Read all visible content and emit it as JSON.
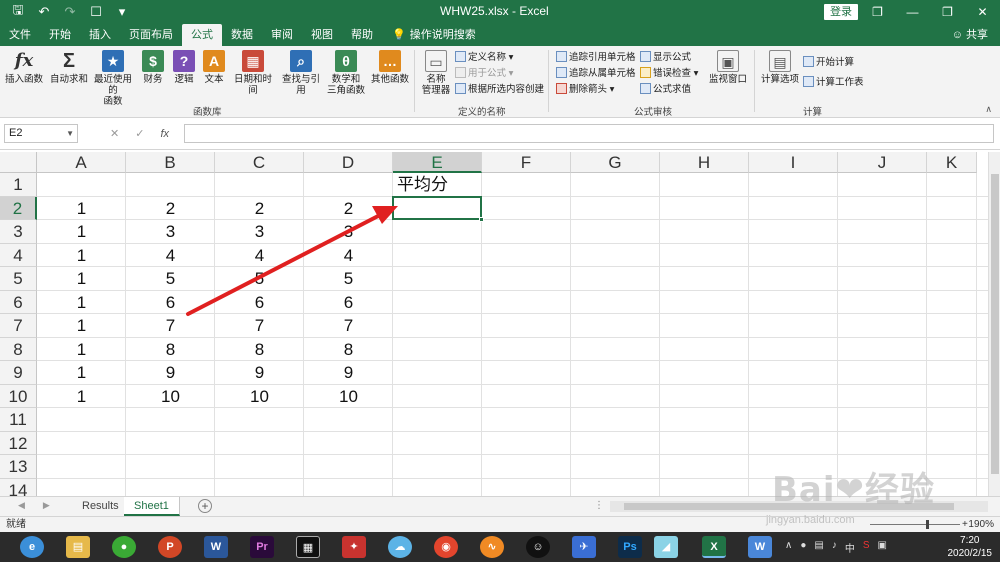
{
  "titlebar": {
    "title": "WHW25.xlsx  -  Excel",
    "login": "登录",
    "qat": [
      "🖫",
      "↶",
      "↷",
      "☐",
      "▾"
    ],
    "controls": [
      "❐",
      "—",
      "❐",
      "✕"
    ]
  },
  "tabs": [
    "文件",
    "开始",
    "插入",
    "页面布局",
    "公式",
    "数据",
    "审阅",
    "视图",
    "帮助"
  ],
  "active_tab": "公式",
  "tell_me": "操作说明搜索",
  "share": "共享",
  "ribbon": {
    "insert_function": "插入函数",
    "autosum": "自动求和",
    "recent": "最近使用的",
    "recent2": "函数",
    "financial": "财务",
    "logical": "逻辑",
    "text": "文本",
    "datetime": "日期和时间",
    "lookup": "查找与引用",
    "math": "数学和",
    "math2": "三角函数",
    "other": "其他函数",
    "group_library": "函数库",
    "name_manager": "名称",
    "name_manager2": "管理器",
    "define_name": "定义名称",
    "use_in_formula": "用于公式",
    "create_from_selection": "根据所选内容创建",
    "group_names": "定义的名称",
    "trace_precedents": "追踪引用单元格",
    "trace_dependents": "追踪从属单元格",
    "remove_arrows": "删除箭头",
    "show_formulas": "显示公式",
    "error_checking": "错误检查",
    "evaluate_formula": "公式求值",
    "group_audit": "公式审核",
    "watch_window": "监视窗口",
    "calc_options": "计算选项",
    "calc_now": "开始计算",
    "calc_sheet": "计算工作表",
    "group_calc": "计算"
  },
  "formula_bar": {
    "name_box": "E2",
    "fx": "fx",
    "cancel": "✕",
    "enter": "✓",
    "formula": ""
  },
  "grid": {
    "columns": [
      "A",
      "B",
      "C",
      "D",
      "E",
      "F",
      "G",
      "H",
      "I",
      "J",
      "K"
    ],
    "rows": [
      "1",
      "2",
      "3",
      "4",
      "5",
      "6",
      "7",
      "8",
      "9",
      "10",
      "11",
      "12",
      "13",
      "14"
    ],
    "selected_column": "E",
    "selected_row": "2",
    "header_e1": "平均分",
    "data": [
      [
        "1",
        "2",
        "2",
        "2"
      ],
      [
        "1",
        "3",
        "3",
        "3"
      ],
      [
        "1",
        "4",
        "4",
        "4"
      ],
      [
        "1",
        "5",
        "5",
        "5"
      ],
      [
        "1",
        "6",
        "6",
        "6"
      ],
      [
        "1",
        "7",
        "7",
        "7"
      ],
      [
        "1",
        "8",
        "8",
        "8"
      ],
      [
        "1",
        "9",
        "9",
        "9"
      ],
      [
        "1",
        "10",
        "10",
        "10"
      ]
    ],
    "annotation_arrow_color": "#e02020"
  },
  "sheets": [
    "Results",
    "Sheet1"
  ],
  "active_sheet": "Sheet1",
  "status": {
    "ready": "就绪",
    "zoom": "190%"
  },
  "taskbar": {
    "time": "7:20",
    "date": "2020/2/15"
  },
  "watermark": {
    "text": "Bai❤经验",
    "sub": "jingyan.baidu.com"
  },
  "colors": {
    "excel_green": "#217346",
    "ribbon_bg": "#f3f3f3",
    "taskbar": "#2b2b2b"
  }
}
